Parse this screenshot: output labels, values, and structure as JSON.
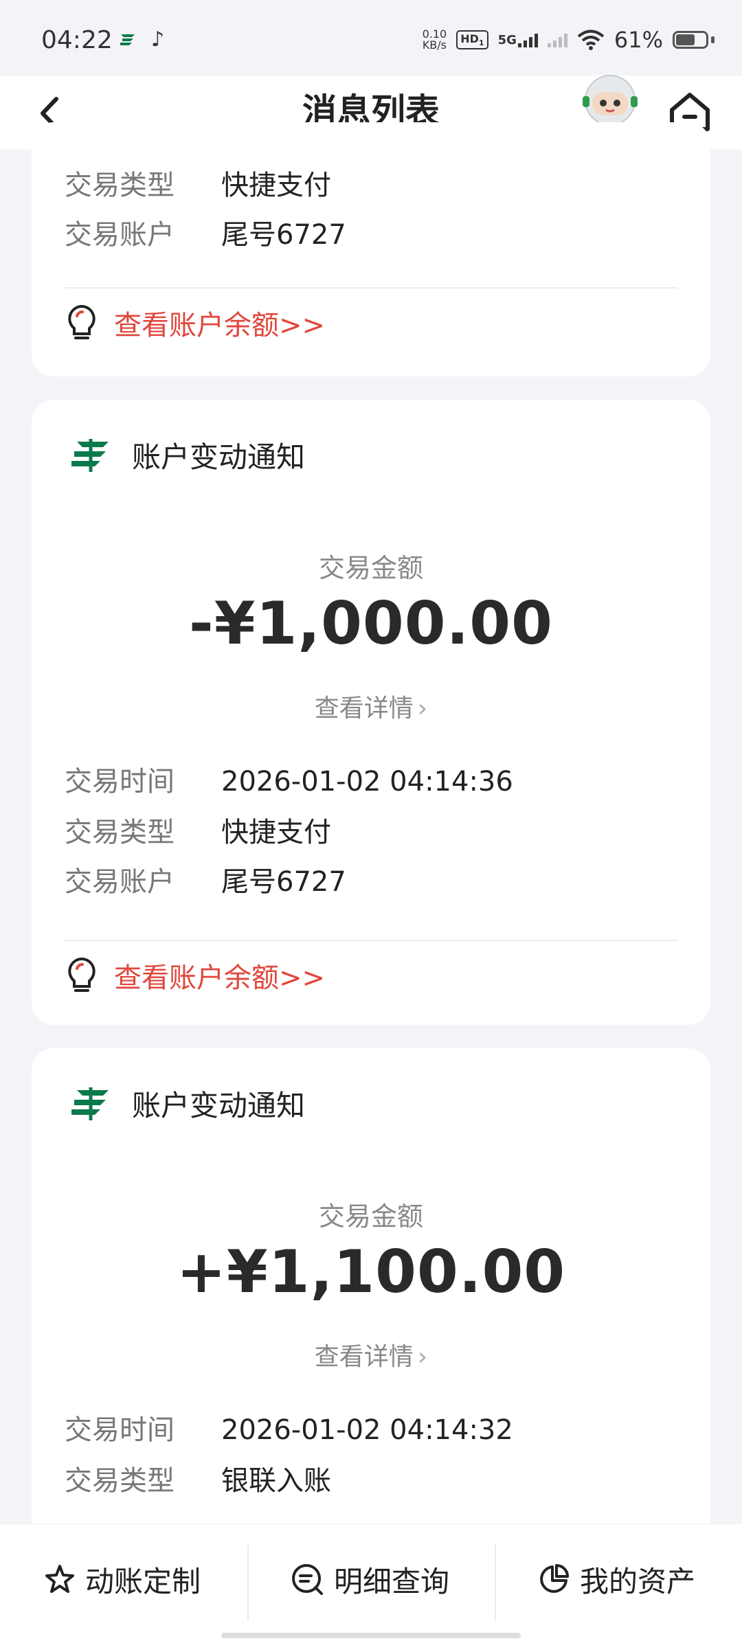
{
  "status_bar": {
    "time": "04:22",
    "net_speed_value": "0.10",
    "net_speed_unit": "KB/s",
    "hd_label": "HD",
    "hd_sub": "1",
    "network": "5G",
    "battery_percent": "61%",
    "icons": [
      "china-post-icon",
      "tiktok-icon",
      "signal-icon",
      "wifi-icon",
      "battery-icon"
    ]
  },
  "header": {
    "title": "消息列表",
    "back_icon": "chevron-left-icon",
    "home_icon": "home-icon",
    "mascot": "robot-mascot"
  },
  "cards": [
    {
      "rows": [
        {
          "label": "交易类型",
          "value": "快捷支付"
        },
        {
          "label": "交易账户",
          "value": "尾号6727"
        }
      ],
      "balance_link": "查看账户余额>>"
    },
    {
      "heading": "账户变动通知",
      "amount_label": "交易金额",
      "amount": "-¥1,000.00",
      "detail_link": "查看详情",
      "rows": [
        {
          "label": "交易时间",
          "value": "2026-01-02 04:14:36"
        },
        {
          "label": "交易类型",
          "value": "快捷支付"
        },
        {
          "label": "交易账户",
          "value": "尾号6727"
        }
      ],
      "balance_link": "查看账户余额>>"
    },
    {
      "heading": "账户变动通知",
      "amount_label": "交易金额",
      "amount": "+¥1,100.00",
      "detail_link": "查看详情",
      "rows": [
        {
          "label": "交易时间",
          "value": "2026-01-02 04:14:32"
        },
        {
          "label": "交易类型",
          "value": "银联入账"
        }
      ]
    }
  ],
  "bottom_nav": [
    {
      "label": "动账定制",
      "icon": "star-outline-icon"
    },
    {
      "label": "明细查询",
      "icon": "search-list-icon"
    },
    {
      "label": "我的资产",
      "icon": "pie-chart-icon"
    }
  ],
  "colors": {
    "accent_red": "#e1463b",
    "brand_green": "#0b7a4b",
    "background": "#f4f4f8"
  }
}
